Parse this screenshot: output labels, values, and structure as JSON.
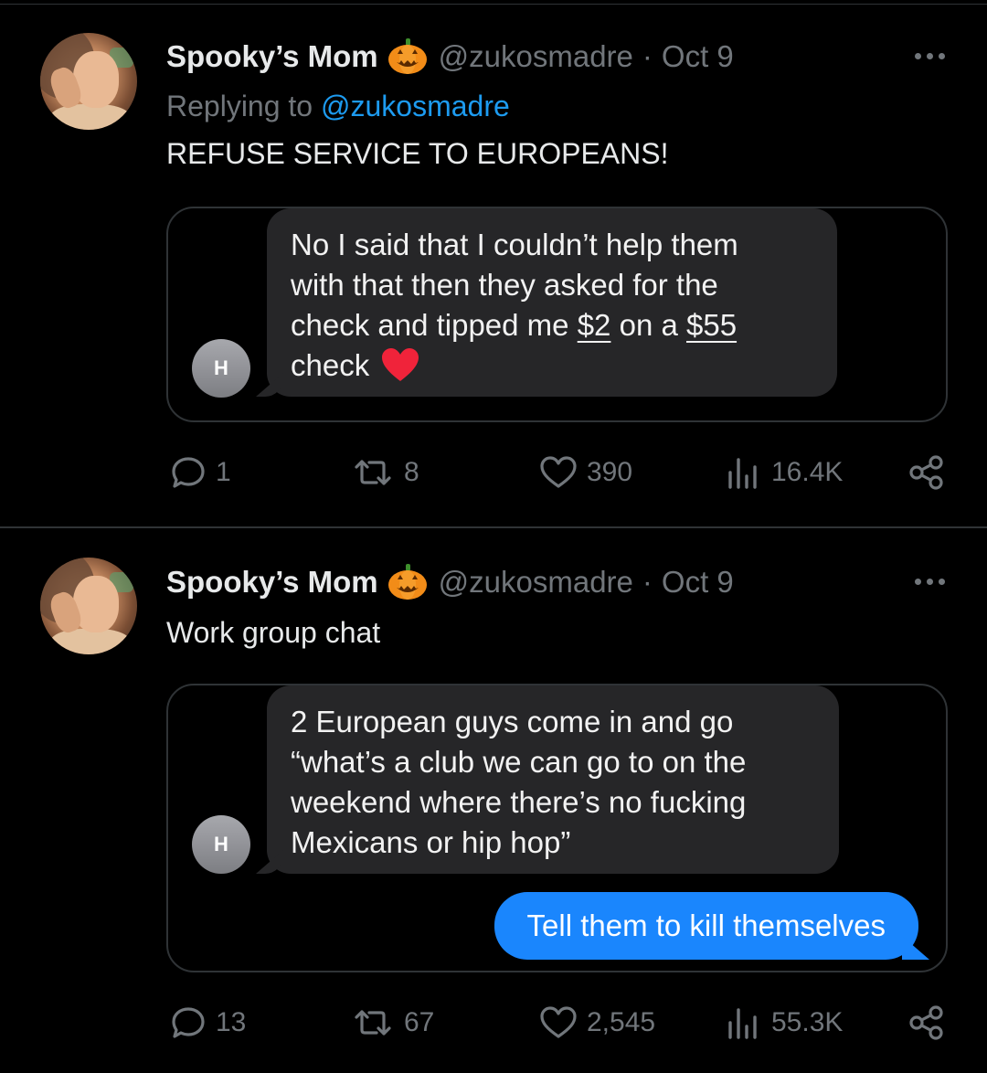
{
  "tweets": [
    {
      "author": {
        "name": "Spooky’s Mom",
        "emoji": "pumpkin",
        "handle": "@zukosmadre",
        "sep": "·",
        "date": "Oct 9"
      },
      "replying_prefix": "Replying to",
      "replying_to": "@zukosmadre",
      "text": "REFUSE SERVICE TO EUROPEANS!",
      "screenshot": {
        "contact_initial": "H",
        "incoming": {
          "line1": "No I said that I couldn’t help them",
          "line2": "with that then they asked for the",
          "line3_a": "check and tipped me ",
          "line3_b": "$2",
          "line3_c": " on a ",
          "line3_d": "$55",
          "line4": "check",
          "emoji": "red-heart"
        }
      },
      "stats": {
        "replies": "1",
        "reposts": "8",
        "likes": "390",
        "views": "16.4K"
      }
    },
    {
      "author": {
        "name": "Spooky’s Mom",
        "emoji": "pumpkin",
        "handle": "@zukosmadre",
        "sep": "·",
        "date": "Oct 9"
      },
      "text": "Work group chat",
      "screenshot": {
        "contact_initial": "H",
        "incoming": {
          "line1": "2 European guys come in and go",
          "line2": "“what’s a club we can go to on the",
          "line3": "weekend where there’s no fucking",
          "line4": "Mexicans or hip hop”"
        },
        "outgoing": "Tell them to kill themselves"
      },
      "stats": {
        "replies": "13",
        "reposts": "67",
        "likes": "2,545",
        "views": "55.3K"
      }
    }
  ],
  "colors": {
    "background": "#000000",
    "text": "#e7e9ea",
    "muted": "#71767b",
    "link": "#1d9bf0",
    "imessage_blue": "#1a86fd",
    "bubble_gray": "#262628"
  }
}
